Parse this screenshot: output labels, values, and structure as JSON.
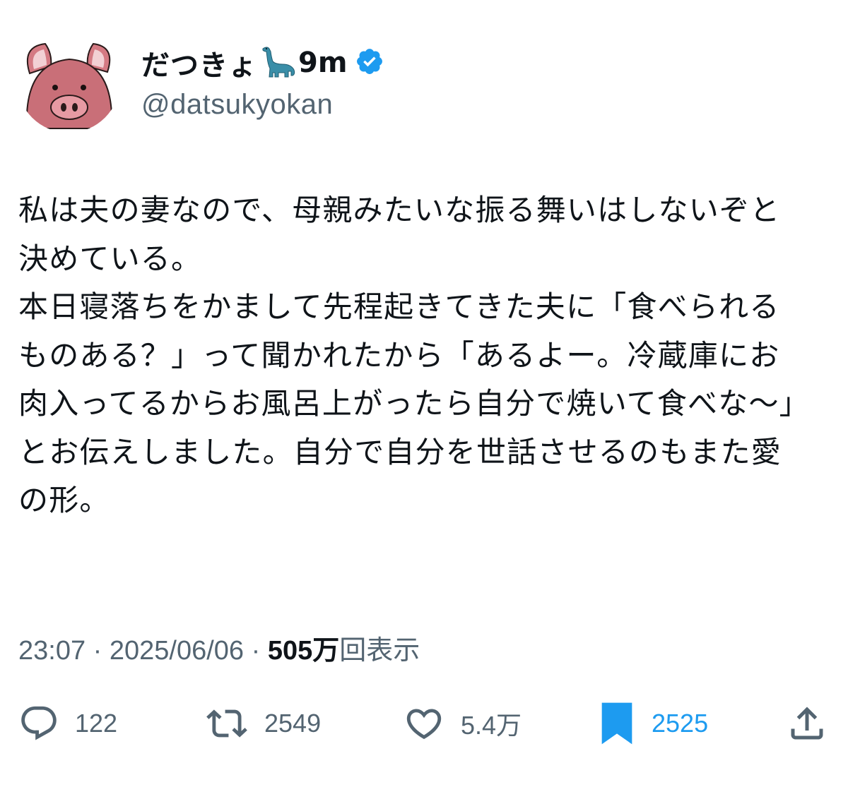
{
  "user": {
    "display_name": "だつきょ",
    "display_suffix": "9m",
    "handle": "@datsukyokan",
    "avatar_icon": "pig-face-icon",
    "emoji_icon": "sauropod-dinosaur-icon",
    "verified_icon": "verified-badge-icon",
    "verified_color": "#1d9bf0"
  },
  "tweet": {
    "text": "私は夫の妻なので、母親みたいな振る舞いはしないぞと決めている。\n本日寝落ちをかまして先程起きてきた夫に「食べられるものある？」って聞かれたから「あるよー。冷蔵庫にお肉入ってるからお風呂上がったら自分で焼いて食べな〜」とお伝えしました。自分で自分を世話させるのもまた愛の形。"
  },
  "meta": {
    "time": "23:07",
    "separator": "·",
    "date": "2025/06/06",
    "views_count": "505万",
    "views_label": "回表示"
  },
  "actions": {
    "reply": {
      "icon": "reply-bubble-icon",
      "count": "122"
    },
    "retweet": {
      "icon": "retweet-icon",
      "count": "2549"
    },
    "like": {
      "icon": "heart-icon",
      "count": "5.4万"
    },
    "bookmark": {
      "icon": "bookmark-filled-icon",
      "count": "2525",
      "active_color": "#1d9bf0"
    },
    "share": {
      "icon": "share-icon"
    }
  },
  "colors": {
    "text": "#0f1419",
    "secondary": "#536471",
    "accent": "#1d9bf0",
    "avatar_pink": "#c96f78"
  }
}
